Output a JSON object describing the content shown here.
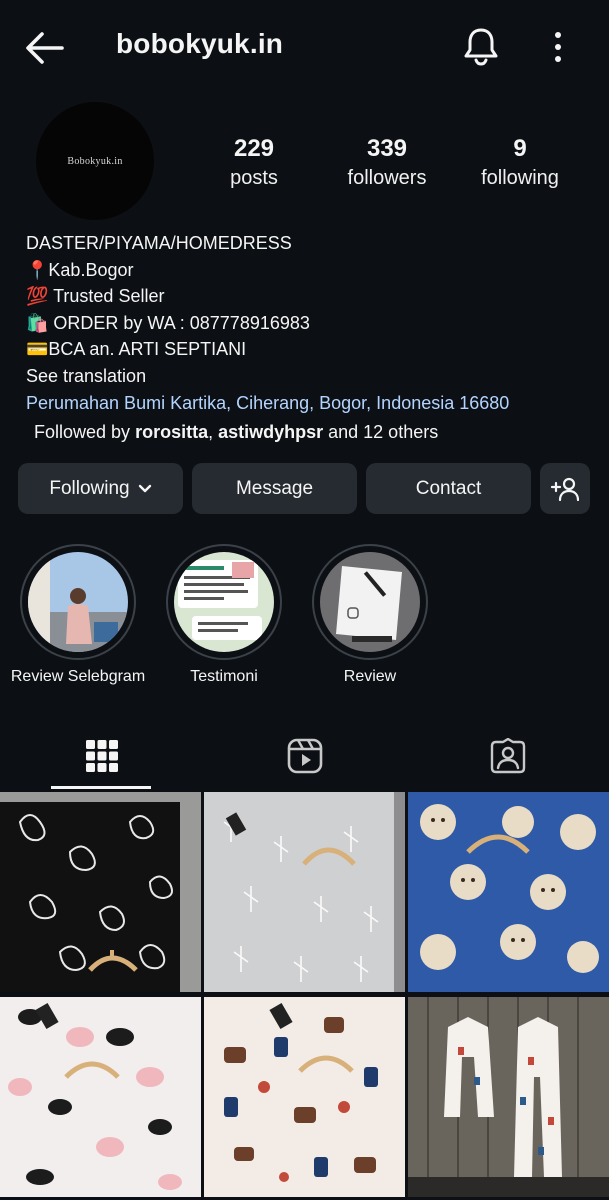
{
  "header": {
    "username": "bobokyuk.in",
    "back_icon": "arrow-left-icon",
    "notification_icon": "bell-icon",
    "menu_icon": "more-vertical-icon"
  },
  "profile": {
    "avatar_text": "Bobokyuk.in",
    "stats": {
      "posts": {
        "value": "229",
        "label": "posts"
      },
      "followers": {
        "value": "339",
        "label": "followers"
      },
      "following": {
        "value": "9",
        "label": "following"
      }
    },
    "bio": {
      "line1": "DASTER/PIYAMA/HOMEDRESS",
      "line2": "📍Kab.Bogor",
      "line3": "💯 Trusted Seller",
      "line4": "🛍️ ORDER by WA : 087778916983",
      "line5": "💳BCA an. ARTI SEPTIANI",
      "see_translation": "See translation",
      "location_link": "Perumahan Bumi Kartika, Ciherang, Bogor, Indonesia 16680"
    },
    "followed_by": {
      "prefix": "Followed by ",
      "user1": "rorositta",
      "separator": ", ",
      "user2": "astiwdyhpsr",
      "suffix": " and 12 others"
    }
  },
  "actions": {
    "following": "Following",
    "message": "Message",
    "contact": "Contact",
    "add_user_icon": "person-add-icon"
  },
  "highlights": [
    {
      "label": "Review Selebgram"
    },
    {
      "label": "Testimoni"
    },
    {
      "label": "Review"
    }
  ],
  "tabs": [
    {
      "icon": "grid-icon",
      "active": true
    },
    {
      "icon": "reels-icon",
      "active": false
    },
    {
      "icon": "tagged-person-icon",
      "active": false
    }
  ],
  "colors": {
    "background": "#0c1014",
    "button": "#262b31",
    "link": "#b3d4ff",
    "text": "#f5f5f5"
  }
}
